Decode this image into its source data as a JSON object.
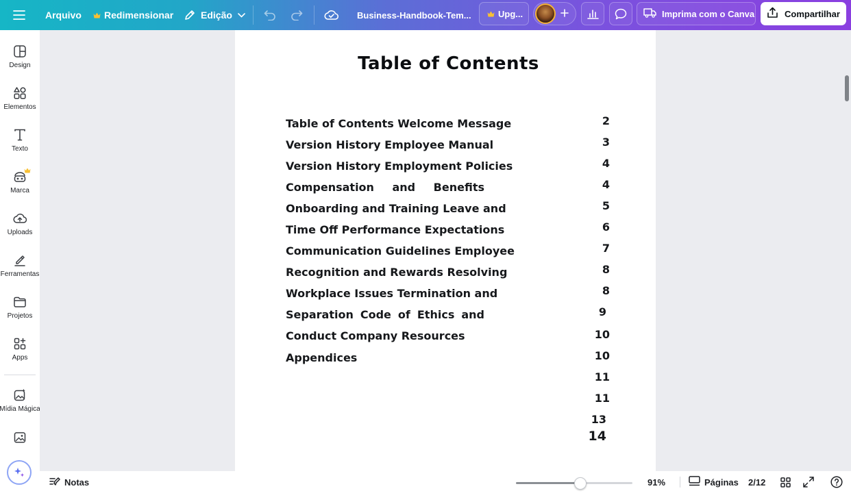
{
  "topbar": {
    "menu_icon": "hamburger-menu-icon",
    "file_label": "Arquivo",
    "resize_label": "Redimensionar",
    "edit_label": "Edição",
    "doc_name": "Business-Handbook-Tem...",
    "upgrade_label": "Upg...",
    "print_label": "Imprima com o Canva",
    "share_label": "Compartilhar",
    "crown_color": "#f8c033"
  },
  "sidebar": {
    "items": [
      {
        "label": "Design",
        "icon": "design-icon"
      },
      {
        "label": "Elementos",
        "icon": "elements-icon"
      },
      {
        "label": "Texto",
        "icon": "text-icon"
      },
      {
        "label": "Marca",
        "icon": "brand-icon"
      },
      {
        "label": "Uploads",
        "icon": "cloud-upload-icon"
      },
      {
        "label": "Ferramentas",
        "icon": "draw-tools-icon"
      },
      {
        "label": "Projetos",
        "icon": "folder-icon"
      },
      {
        "label": "Apps",
        "icon": "apps-icon"
      },
      {
        "label": "Mídia Mágica",
        "icon": "magic-media-icon"
      },
      {
        "label": "",
        "icon": "image-icon"
      }
    ]
  },
  "document": {
    "title": "Table of Contents",
    "lines": [
      "Table of Contents Welcome Message",
      "Version History Employee Manual",
      "Version History Employment Policies",
      "Compensation and Benefits",
      "Onboarding and Training Leave and",
      "Time Off Performance Expectations",
      "Communication Guidelines Employee",
      "Recognition and Rewards Resolving",
      "Workplace Issues Termination and",
      "Separation Code of Ethics and",
      "Conduct Company Resources",
      "Appendices"
    ],
    "page_numbers": [
      "2",
      "3",
      "4",
      "4",
      "5",
      "6",
      "7",
      "8",
      "8",
      "9",
      "10",
      "10",
      "11",
      "11",
      "13",
      "14"
    ]
  },
  "bottombar": {
    "notes_label": "Notas",
    "zoom": "91%",
    "zoom_fraction": 0.55,
    "pages_label": "Páginas",
    "page_indicator": "2/12"
  }
}
